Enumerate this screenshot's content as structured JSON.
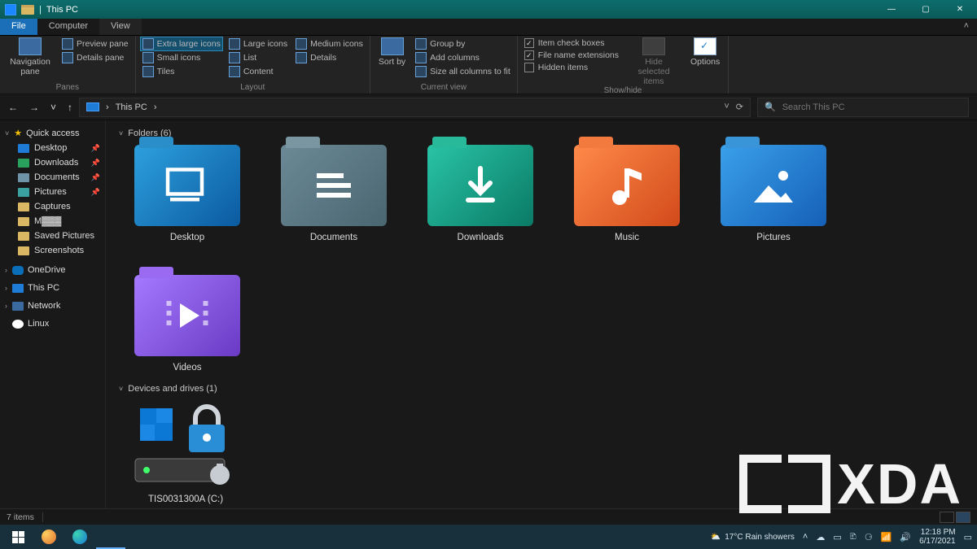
{
  "window": {
    "title": "This PC"
  },
  "tabs": {
    "file": "File",
    "computer": "Computer",
    "view": "View"
  },
  "ribbon": {
    "panes": {
      "navigation": "Navigation pane",
      "preview": "Preview pane",
      "details": "Details pane",
      "group": "Panes"
    },
    "layout": {
      "extra_large": "Extra large icons",
      "large": "Large icons",
      "medium": "Medium icons",
      "small": "Small icons",
      "list": "List",
      "details": "Details",
      "tiles": "Tiles",
      "content": "Content",
      "group": "Layout"
    },
    "currentview": {
      "sortby": "Sort by",
      "groupby": "Group by",
      "addcolumns": "Add columns",
      "sizeall": "Size all columns to fit",
      "group": "Current view"
    },
    "showhide": {
      "itemcb": "Item check boxes",
      "fileext": "File name extensions",
      "hidden": "Hidden items",
      "hidesel": "Hide selected items",
      "options": "Options",
      "group": "Show/hide"
    }
  },
  "addr": {
    "location": "This PC",
    "sep": "›"
  },
  "search": {
    "placeholder": "Search This PC",
    "icon": "🔍"
  },
  "nav": {
    "back": "←",
    "fwd": "→",
    "up": "↑",
    "recent": "˅",
    "refresh": "⟳",
    "dd": "˅"
  },
  "sidebar": {
    "quick": "Quick access",
    "items": [
      {
        "label": "Desktop",
        "pin": true
      },
      {
        "label": "Downloads",
        "pin": true
      },
      {
        "label": "Documents",
        "pin": true
      },
      {
        "label": "Pictures",
        "pin": true
      },
      {
        "label": "Captures",
        "pin": false
      },
      {
        "label": "M▓▓▓",
        "pin": false
      },
      {
        "label": "Saved Pictures",
        "pin": false
      },
      {
        "label": "Screenshots",
        "pin": false
      }
    ],
    "onedrive": "OneDrive",
    "thispc": "This PC",
    "network": "Network",
    "linux": "Linux"
  },
  "groups": {
    "folders_hdr": "Folders (6)",
    "drives_hdr": "Devices and drives (1)"
  },
  "folders": [
    {
      "label": "Desktop"
    },
    {
      "label": "Documents"
    },
    {
      "label": "Downloads"
    },
    {
      "label": "Music"
    },
    {
      "label": "Pictures"
    },
    {
      "label": "Videos"
    }
  ],
  "drive": {
    "label": "TIS0031300A (C:)"
  },
  "status": {
    "items": "7 items"
  },
  "taskbar": {
    "weather": "17°C  Rain showers",
    "time": "12:18 PM",
    "date": "6/17/2021"
  },
  "watermark": {
    "text": "XDA"
  }
}
